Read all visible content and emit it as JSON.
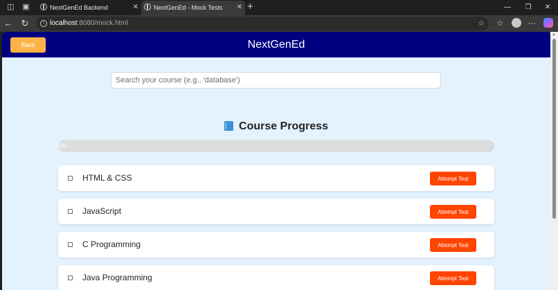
{
  "browser": {
    "tabs": [
      {
        "title": "NextGenEd Backend",
        "active": false
      },
      {
        "title": "NextGenEd - Mock Tests",
        "active": true
      }
    ],
    "url_host": "localhost",
    "url_path": ":8080/mock.html"
  },
  "header": {
    "back_label": "Back",
    "site_title": "NextGenEd",
    "bg_color": "#000080",
    "back_color": "#ffb347"
  },
  "search": {
    "placeholder": "Search your course (e.g., 'database')",
    "value": ""
  },
  "progress_section": {
    "title": "Course Progress",
    "icon": "book-icon",
    "percent_label": "0%",
    "percent": 0
  },
  "courses": [
    {
      "name": "HTML & CSS",
      "checked": false,
      "action_label": "Attempt Test"
    },
    {
      "name": "JavaScript",
      "checked": false,
      "action_label": "Attempt Test"
    },
    {
      "name": "C Programming",
      "checked": false,
      "action_label": "Attempt Test"
    },
    {
      "name": "Java Programming",
      "checked": false,
      "action_label": "Attempt Test"
    }
  ],
  "colors": {
    "page_bg": "#e3f2fd",
    "attempt_button": "#ff4500"
  }
}
